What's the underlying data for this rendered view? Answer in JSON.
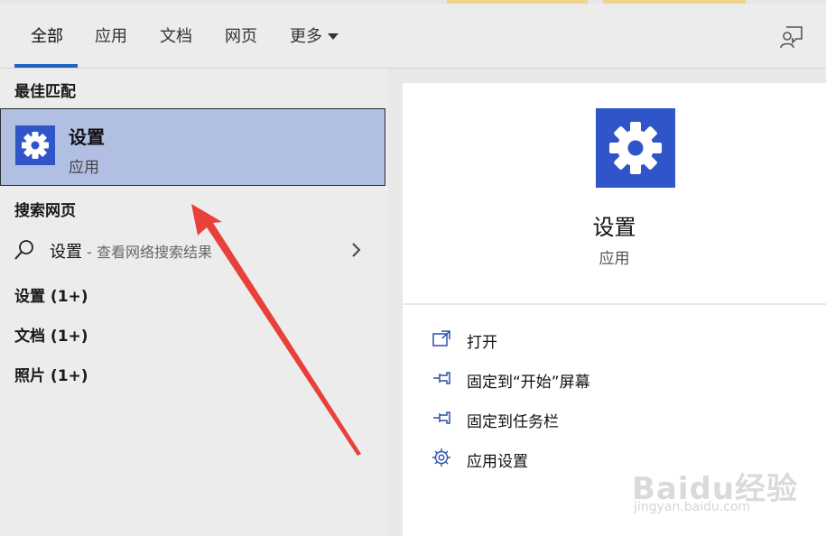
{
  "tabs": [
    {
      "label": "全部",
      "active": true
    },
    {
      "label": "应用",
      "active": false
    },
    {
      "label": "文档",
      "active": false
    },
    {
      "label": "网页",
      "active": false
    },
    {
      "label": "更多",
      "active": false
    }
  ],
  "colors": {
    "accent": "#1f63c4",
    "tile": "#2f55c8",
    "selected_bg": "#b1bfe3",
    "arrow": "#e8403a"
  },
  "left": {
    "best_match_title": "最佳匹配",
    "best_match": {
      "name": "设置",
      "type": "应用",
      "icon": "gear-icon"
    },
    "web_title": "搜索网页",
    "web_result": {
      "query": "设置",
      "separator": " - ",
      "hint": "查看网络搜索结果"
    },
    "groups": [
      "设置 (1+)",
      "文档 (1+)",
      "照片 (1+)"
    ]
  },
  "right": {
    "app": {
      "name": "设置",
      "type": "应用",
      "icon": "gear-icon"
    },
    "actions": [
      {
        "label": "打开",
        "icon": "open-icon"
      },
      {
        "label": "固定到“开始”屏幕",
        "icon": "pin-icon"
      },
      {
        "label": "固定到任务栏",
        "icon": "pin-icon"
      },
      {
        "label": "应用设置",
        "icon": "gear-outline-icon"
      }
    ]
  },
  "watermark": {
    "text": "Baidu经验",
    "url": "jingyan.baidu.com"
  }
}
